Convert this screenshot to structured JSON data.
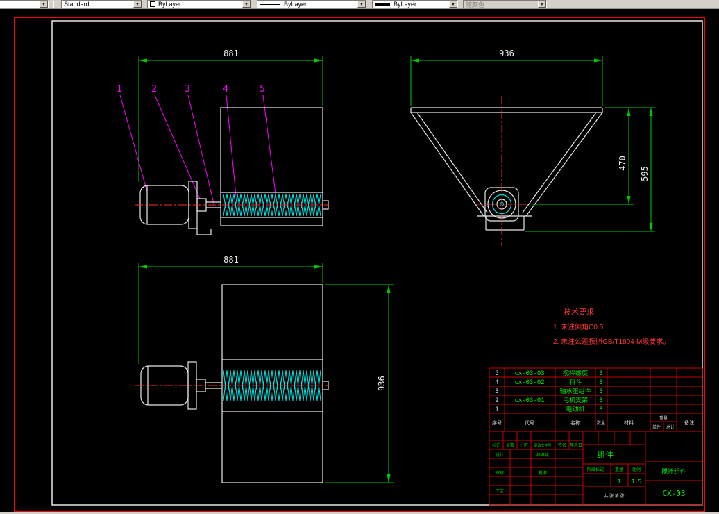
{
  "toolbar": {
    "style_value": "Standard",
    "color_value": "ByLayer",
    "linetype_value": "ByLayer",
    "lineweight_value": "ByLayer",
    "plot_style_value": "随颜色",
    "dropdown_glyph": "▼"
  },
  "drawing": {
    "dims": {
      "side_width": "881",
      "front_width": "936",
      "front_center_height": "470",
      "front_total_height": "595",
      "top_width": "881",
      "top_height": "936"
    },
    "callouts": [
      "1",
      "2",
      "3",
      "4",
      "5"
    ],
    "notes": {
      "title": "技术要求",
      "line1": "1. 未注倒角C0.5.",
      "line2": "2. 未注公差按照GB/T1804-M级要求。"
    },
    "parts_list": {
      "headers": [
        "序号",
        "代号",
        "名称",
        "数量",
        "材料",
        "重量",
        "备注"
      ],
      "weight_sub": [
        "单件",
        "总计"
      ],
      "rows": [
        {
          "no": "5",
          "code": "cx-03-03",
          "name": "搅拌螺旋",
          "qty": "3"
        },
        {
          "no": "4",
          "code": "cx-03-02",
          "name": "料斗",
          "qty": "3"
        },
        {
          "no": "3",
          "code": "",
          "name": "轴承座组件",
          "qty": "3"
        },
        {
          "no": "2",
          "code": "cx-03-01",
          "name": "电机支架",
          "qty": "3"
        },
        {
          "no": "1",
          "code": "",
          "name": "电动机",
          "qty": "3"
        }
      ]
    },
    "title_block": {
      "assembly_label": "组件",
      "product_name": "搅拌组件",
      "drawing_number": "CX-03",
      "scale": "1:5",
      "quantity": "1",
      "sheet_note": "共 张 第 张",
      "fields": {
        "mark": "标记",
        "count": "处数",
        "zone": "分区",
        "change_file": "更改文件号",
        "sign": "签名",
        "date": "年月日",
        "design": "设计",
        "standardize": "标准化",
        "review": "审核",
        "process": "工艺",
        "approve": "批准",
        "stage_mark": "阶段标记",
        "weight": "重量",
        "scale_label": "比例"
      }
    },
    "colors": {
      "dimension_green": "#00c800",
      "callout_magenta": "#ff00ff",
      "screw_cyan": "#00e5e5",
      "centerline_red": "#ff0000",
      "outline_white": "#e8e8e8",
      "table_red": "#c80000"
    }
  }
}
